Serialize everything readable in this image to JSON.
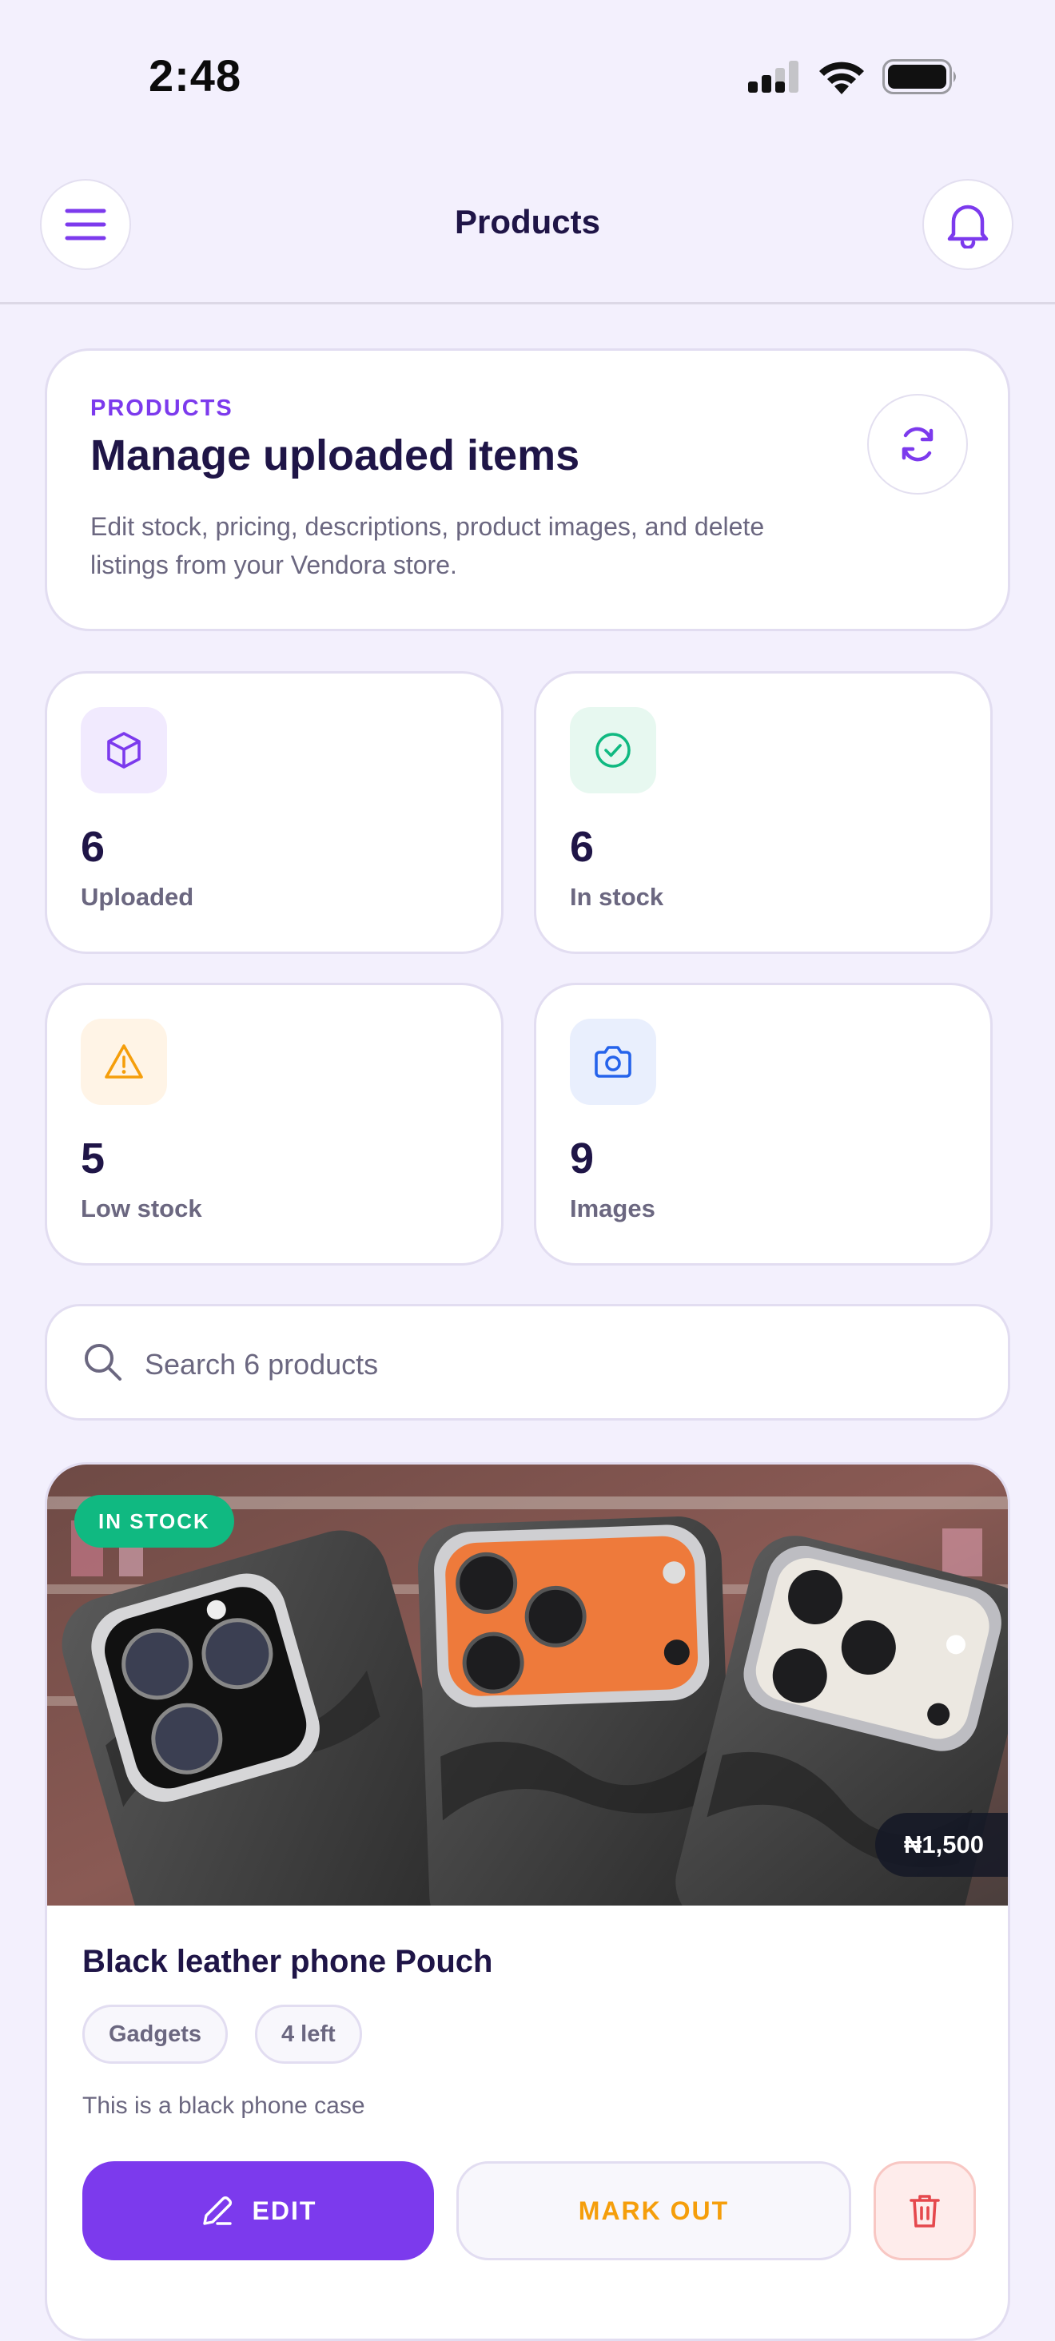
{
  "status_bar": {
    "time": "2:48"
  },
  "header": {
    "title": "Products"
  },
  "intro": {
    "eyebrow": "PRODUCTS",
    "title": "Manage uploaded items",
    "description": "Edit stock, pricing, descriptions, product images, and delete listings from your Vendora store."
  },
  "stats": [
    {
      "value": "6",
      "label": "Uploaded",
      "icon": "box-icon",
      "color": "#7c3aed",
      "bg": "#f1eafe"
    },
    {
      "value": "6",
      "label": "In stock",
      "icon": "check-circle-icon",
      "color": "#10b981",
      "bg": "#e7f8f0"
    },
    {
      "value": "5",
      "label": "Low stock",
      "icon": "warning-icon",
      "color": "#f59e0b",
      "bg": "#fff4e6"
    },
    {
      "value": "9",
      "label": "Images",
      "icon": "camera-icon",
      "color": "#2563eb",
      "bg": "#e9effd"
    }
  ],
  "search": {
    "placeholder": "Search 6 products",
    "value": ""
  },
  "product": {
    "status": "IN STOCK",
    "price": "₦1,500",
    "name": "Black leather phone Pouch",
    "category": "Gadgets",
    "stock": "4 left",
    "description": "This is a black phone case",
    "edit_label": "EDIT",
    "markout_label": "MARK OUT"
  },
  "colors": {
    "accent": "#7c3aed",
    "success": "#10b981",
    "warning": "#f59e0b",
    "danger": "#e5484d",
    "text": "#1f1547",
    "muted": "#6b6780"
  }
}
